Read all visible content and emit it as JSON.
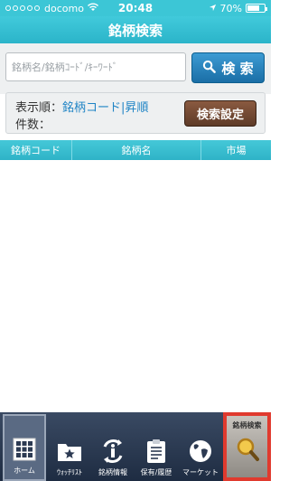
{
  "status_bar": {
    "carrier": "docomo",
    "time": "20:48",
    "battery": "70%",
    "battery_level": 0.7
  },
  "title": "銘柄検索",
  "search": {
    "placeholder": "銘柄名/銘柄ｺｰﾄﾞ/ｷｰﾜｰﾄﾞ",
    "value": "",
    "button_label": "検 索"
  },
  "sort_panel": {
    "sort_label": "表示順：",
    "sort_value": "銘柄コード|昇順",
    "count_label": "件数：",
    "settings_button": "検索設定"
  },
  "table": {
    "columns": [
      "銘柄コード",
      "銘柄名",
      "市場"
    ],
    "rows": []
  },
  "tabs": [
    {
      "label": "ホーム",
      "icon": "grid-icon"
    },
    {
      "label": "ｳｫｯﾁﾘｽﾄ",
      "icon": "star-folder-icon"
    },
    {
      "label": "銘柄情報",
      "icon": "info-icon"
    },
    {
      "label": "保有/履歴",
      "icon": "clipboard-icon"
    },
    {
      "label": "マーケット",
      "icon": "globe-icon"
    },
    {
      "label": "銘柄検索",
      "icon": "magnifier-icon"
    }
  ],
  "colors": {
    "accent": "#3cc6d6",
    "search_button": "#1a6ea6",
    "settings_button": "#5e3b28",
    "tab_bar": "#1e2c42",
    "active_tab_highlight": "#e03a2e"
  }
}
